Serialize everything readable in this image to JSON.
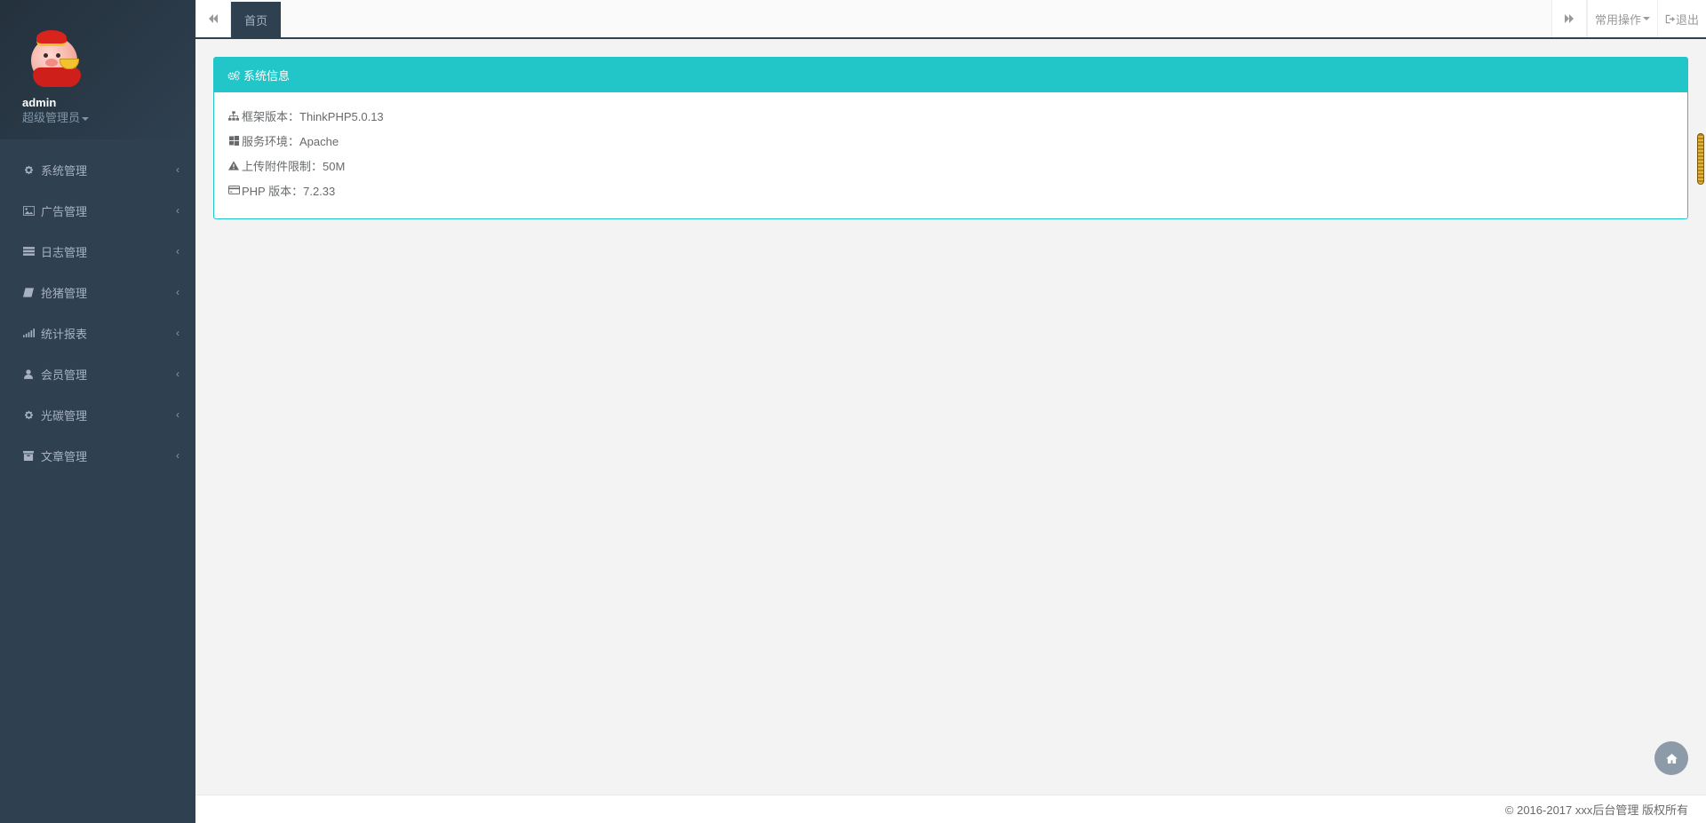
{
  "profile": {
    "username": "admin",
    "role": "超级管理员"
  },
  "sidebar": {
    "items": [
      {
        "label": "系统管理",
        "icon": "gear-icon"
      },
      {
        "label": "广告管理",
        "icon": "image-icon"
      },
      {
        "label": "日志管理",
        "icon": "server-icon"
      },
      {
        "label": "抢猪管理",
        "icon": "book-icon"
      },
      {
        "label": "统计报表",
        "icon": "signal-icon"
      },
      {
        "label": "会员管理",
        "icon": "user-icon"
      },
      {
        "label": "光碳管理",
        "icon": "gear-icon"
      },
      {
        "label": "文章管理",
        "icon": "archive-icon"
      }
    ]
  },
  "topbar": {
    "active_tab": "首页",
    "common_actions": "常用操作",
    "logout": "退出"
  },
  "panel": {
    "title": "系统信息",
    "rows": [
      {
        "label": "框架版本：ThinkPHP5.0.13",
        "icon": "sitemap-icon"
      },
      {
        "label": "服务环境：Apache",
        "icon": "windows-icon"
      },
      {
        "label": "上传附件限制：50M",
        "icon": "warning-icon"
      },
      {
        "label": "PHP 版本：7.2.33",
        "icon": "credit-card-icon"
      }
    ]
  },
  "footer": {
    "copyright": "© 2016-2017 xxx后台管理 版权所有"
  },
  "colors": {
    "sidebar_bg": "#2f4050",
    "accent": "#23c6c8",
    "content_bg": "#f3f3f4"
  }
}
